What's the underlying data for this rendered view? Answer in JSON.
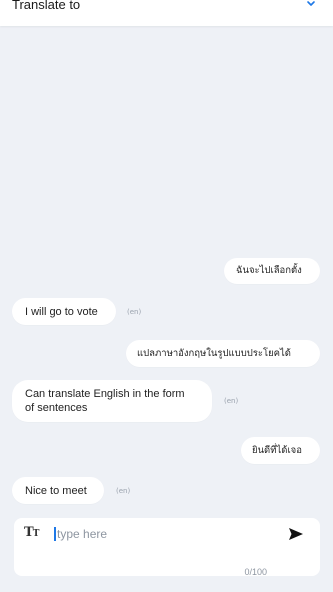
{
  "header": {
    "title": "Translate to",
    "chevron_icon": "chevron-down-icon",
    "accent": "#1e78e6"
  },
  "messages": [
    {
      "type": "source",
      "text": "ฉันจะไปเลือกตั้ง"
    },
    {
      "type": "translation",
      "text": "I will go to vote",
      "lang": "(en)"
    },
    {
      "type": "source",
      "text": "แปลภาษาอังกฤษในรูปแบบประโยคได้"
    },
    {
      "type": "translation",
      "text_line1": "Can translate English in the form",
      "text_line2": "of sentences",
      "lang": "(en)"
    },
    {
      "type": "source",
      "text": "ยินดีที่ได้เจอ"
    },
    {
      "type": "translation",
      "text": "Nice to meet",
      "lang": "(en)"
    }
  ],
  "composer": {
    "font_size_icon": "text-size-icon",
    "placeholder": "type here",
    "value": "",
    "send_icon": "send-icon",
    "counter": "0/100"
  }
}
